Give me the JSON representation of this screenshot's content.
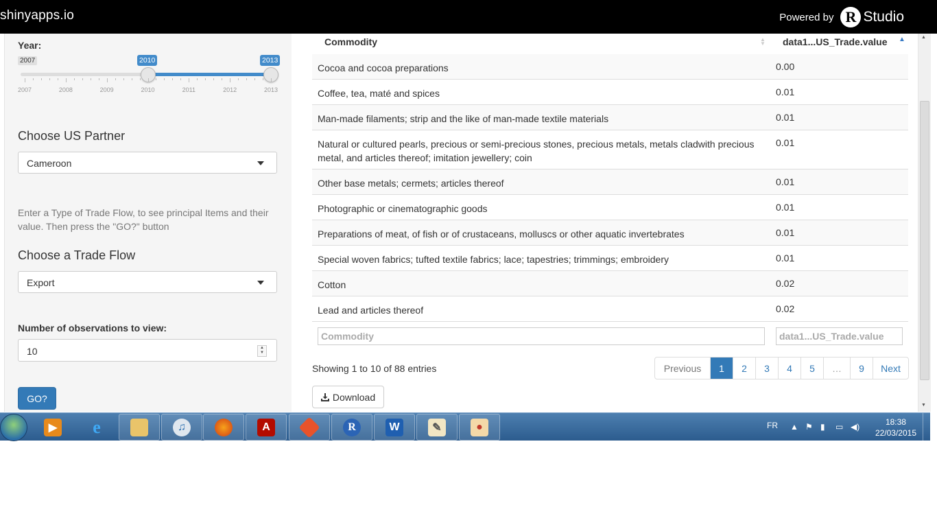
{
  "header": {
    "brand": "shinyapps.io",
    "powered_by": "Powered by",
    "r_logo": "R",
    "studio": "Studio"
  },
  "sidebar": {
    "year_label": "Year:",
    "slider": {
      "min": "2007",
      "max": "2013",
      "from": "2010",
      "to": "2013",
      "from_value": 2010,
      "to_value": 2013,
      "ticks": [
        "2007",
        "2008",
        "2009",
        "2010",
        "2011",
        "2012",
        "2013"
      ]
    },
    "partner_title": "Choose US Partner",
    "partner_value": "Cameroon",
    "help_text": "Enter a Type of Trade Flow, to see principal Items and their value. Then press the \"GO?\" button",
    "flow_title": "Choose a Trade Flow",
    "flow_value": "Export",
    "obs_label": "Number of observations to view:",
    "obs_value": "10",
    "go_label": "GO?"
  },
  "table": {
    "col_commodity": "Commodity",
    "col_value": "data1...US_Trade.value",
    "rows": [
      {
        "commodity": "Cocoa and cocoa preparations",
        "value": "0.00"
      },
      {
        "commodity": "Coffee, tea, maté and spices",
        "value": "0.01"
      },
      {
        "commodity": "Man-made filaments; strip and the like of man-made textile materials",
        "value": "0.01"
      },
      {
        "commodity": "Natural or cultured pearls, precious or semi-precious stones, precious metals, metals cladwith precious metal, and articles thereof; imitation jewellery; coin",
        "value": "0.01"
      },
      {
        "commodity": "Other base metals; cermets; articles thereof",
        "value": "0.01"
      },
      {
        "commodity": "Photographic or cinematographic goods",
        "value": "0.01"
      },
      {
        "commodity": "Preparations of meat, of fish or of crustaceans, molluscs or other aquatic invertebrates",
        "value": "0.01"
      },
      {
        "commodity": "Special woven fabrics; tufted textile fabrics; lace; tapestries; trimmings; embroidery",
        "value": "0.01"
      },
      {
        "commodity": "Cotton",
        "value": "0.02"
      },
      {
        "commodity": "Lead and articles thereof",
        "value": "0.02"
      }
    ],
    "filter_commodity_placeholder": "Commodity",
    "filter_value_placeholder": "data1...US_Trade.value",
    "info": "Showing 1 to 10 of 88 entries",
    "pagination": {
      "previous": "Previous",
      "pages": [
        "1",
        "2",
        "3",
        "4",
        "5"
      ],
      "ellipsis": "…",
      "last": "9",
      "next": "Next",
      "current": "1"
    },
    "download_label": "Download"
  },
  "taskbar": {
    "lang": "FR",
    "time": "18:38",
    "date": "22/03/2015",
    "apps": [
      "windows-media-player",
      "internet-explorer",
      "file-explorer",
      "itunes",
      "firefox",
      "adobe-acrobat",
      "git",
      "r",
      "microsoft-word",
      "rstudio-editor",
      "paint"
    ]
  }
}
